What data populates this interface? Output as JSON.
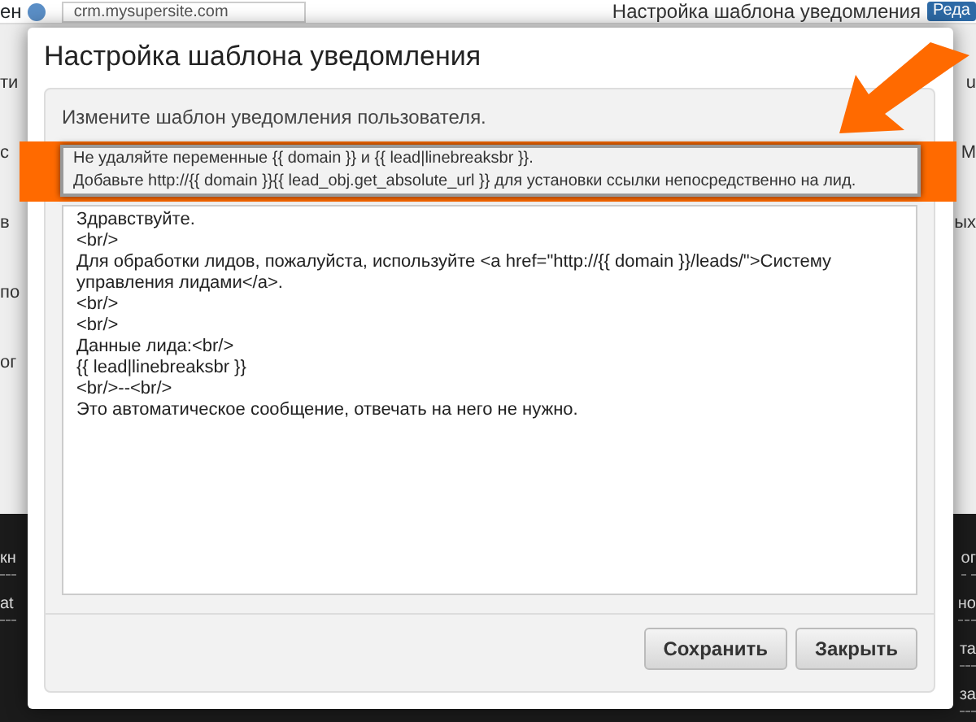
{
  "background": {
    "top_bar": {
      "label": "ен",
      "select_value": "crm.mysupersite.com",
      "page_title": "Настройка шаблона уведомления",
      "edit_button": "Реда"
    },
    "left_fragments": [
      "ти",
      "с",
      "в",
      "по",
      "ог"
    ],
    "right_fragments": [
      "u",
      "М",
      "ых"
    ],
    "footer_left": [
      "кн",
      "at"
    ],
    "footer_right": [
      "ог",
      "но",
      "та",
      "за"
    ]
  },
  "modal": {
    "title": "Настройка шаблона уведомления",
    "hint": "Измените шаблон уведомления пользователя.",
    "notes": [
      "Не удаляйте переменные {{ domain }} и {{ lead|linebreaksbr }}.",
      "Добавьте http://{{ domain }}{{ lead_obj.get_absolute_url }} для установки ссылки непосредственно на лид."
    ],
    "template": "Здравствуйте.\n<br/>\nДля обработки лидов, пожалуйста, используйте <a href=\"http://{{ domain }}/leads/\">Систему управления лидами</a>.\n<br/>\n<br/>\nДанные лида:<br/>\n{{ lead|linebreaksbr }}\n<br/>--<br/>\nЭто автоматическое сообщение, отвечать на него не нужно.",
    "buttons": [
      "Сохранить",
      "Закрыть"
    ]
  }
}
